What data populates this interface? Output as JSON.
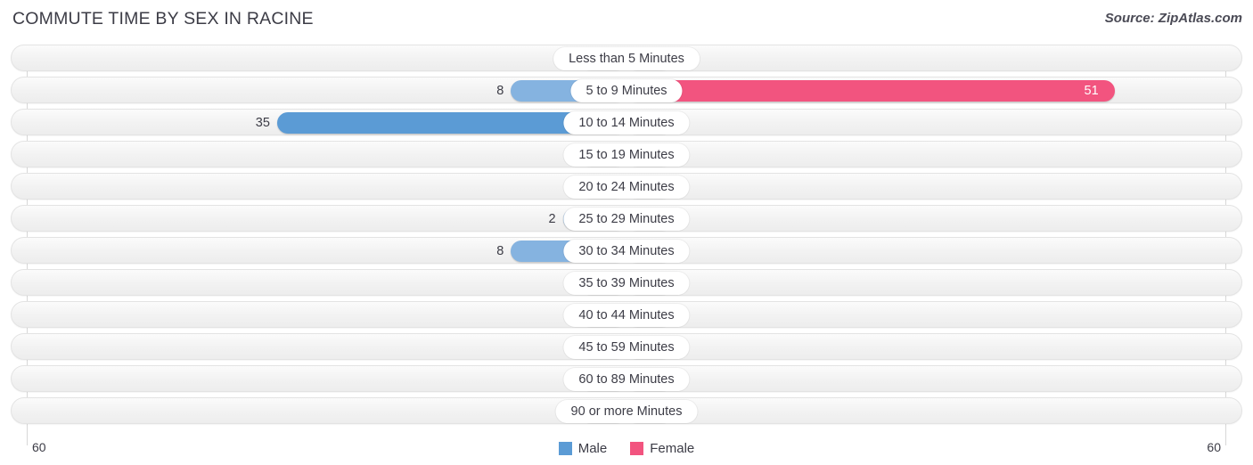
{
  "header": {
    "title": "COMMUTE TIME BY SEX IN RACINE",
    "source": "Source: ZipAtlas.com"
  },
  "axis": {
    "left_label": "60",
    "right_label": "60"
  },
  "legend": {
    "male_label": "Male",
    "female_label": "Female"
  },
  "colors": {
    "male": "#5b9bd5",
    "male_light": "#85b3e0",
    "female": "#f2547f",
    "female_light": "#f8a0bd"
  },
  "chart_data": {
    "type": "bar",
    "title": "COMMUTE TIME BY SEX IN RACINE",
    "subtitle": "Source: ZipAtlas.com",
    "orientation": "horizontal-diverging",
    "xlabel": "",
    "ylabel": "",
    "xlim": [
      -60,
      60
    ],
    "axis_end_labels": [
      "60",
      "60"
    ],
    "grid": true,
    "legend_position": "bottom-center",
    "categories": [
      "Less than 5 Minutes",
      "5 to 9 Minutes",
      "10 to 14 Minutes",
      "15 to 19 Minutes",
      "20 to 24 Minutes",
      "25 to 29 Minutes",
      "30 to 34 Minutes",
      "35 to 39 Minutes",
      "40 to 44 Minutes",
      "45 to 59 Minutes",
      "60 to 89 Minutes",
      "90 or more Minutes"
    ],
    "series": [
      {
        "name": "Male",
        "color": "#5b9bd5",
        "values": [
          0,
          8,
          35,
          0,
          0,
          2,
          8,
          0,
          0,
          0,
          0,
          0
        ]
      },
      {
        "name": "Female",
        "color": "#f2547f",
        "values": [
          0,
          51,
          0,
          0,
          0,
          0,
          0,
          0,
          0,
          0,
          0,
          0
        ]
      }
    ]
  }
}
